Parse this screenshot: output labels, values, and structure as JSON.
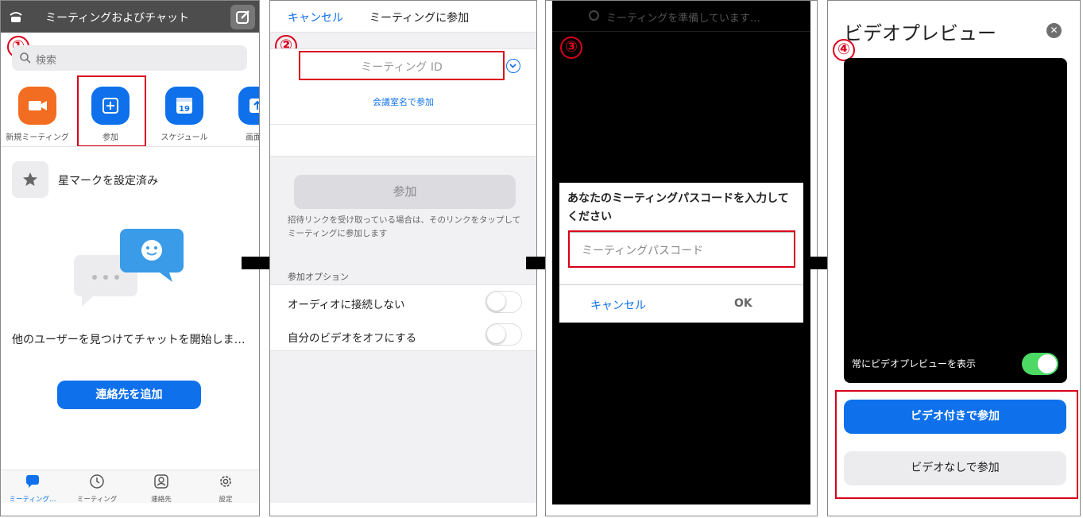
{
  "steps": [
    "①",
    "②",
    "③",
    "④"
  ],
  "panel1": {
    "header_title": "ミーティングおよびチャット",
    "search_placeholder": "検索",
    "quick_actions": [
      {
        "label": "新規ミーティング",
        "color": "#f26d21",
        "icon": "video-camera-icon"
      },
      {
        "label": "参加",
        "color": "#0e71eb",
        "icon": "plus-icon"
      },
      {
        "label": "スケジュール",
        "color": "#0e71eb",
        "icon": "calendar-icon",
        "calendar_day": "19"
      },
      {
        "label": "画面の",
        "color": "#0e71eb",
        "icon": "share-screen-icon"
      }
    ],
    "starred_label": "星マークを設定済み",
    "empty_message": "他のユーザーを見つけてチャットを開始しま…",
    "add_contact_button": "連絡先を追加",
    "tabs": [
      {
        "label": "ミーティング…",
        "icon": "chat-bubble-icon",
        "active": true
      },
      {
        "label": "ミーティング",
        "icon": "clock-icon",
        "active": false
      },
      {
        "label": "連絡先",
        "icon": "contact-icon",
        "active": false
      },
      {
        "label": "設定",
        "icon": "gear-icon",
        "active": false
      }
    ]
  },
  "panel2": {
    "cancel": "キャンセル",
    "title": "ミーティングに参加",
    "meeting_id_placeholder": "ミーティング ID",
    "join_by_room": "会議室名で参加",
    "join_button": "参加",
    "note": "招待リンクを受け取っている場合は、そのリンクをタップしてミーティングに参加します",
    "options_header": "参加オプション",
    "options": [
      {
        "label": "オーディオに接続しない",
        "on": false
      },
      {
        "label": "自分のビデオをオフにする",
        "on": false
      }
    ]
  },
  "panel3": {
    "preparing": "ミーティングを準備しています…",
    "dialog_message": "あなたのミーティングパスコードを入力してください",
    "passcode_placeholder": "ミーティングパスコード",
    "cancel": "キャンセル",
    "ok": "OK"
  },
  "panel4": {
    "title": "ビデオプレビュー",
    "always_show": "常にビデオプレビューを表示",
    "always_show_on": true,
    "join_with_video": "ビデオ付きで参加",
    "join_without_video": "ビデオなしで参加"
  },
  "colors": {
    "accent": "#0e71eb",
    "highlight": "#d9001b",
    "toggle_on": "#4cd964"
  }
}
